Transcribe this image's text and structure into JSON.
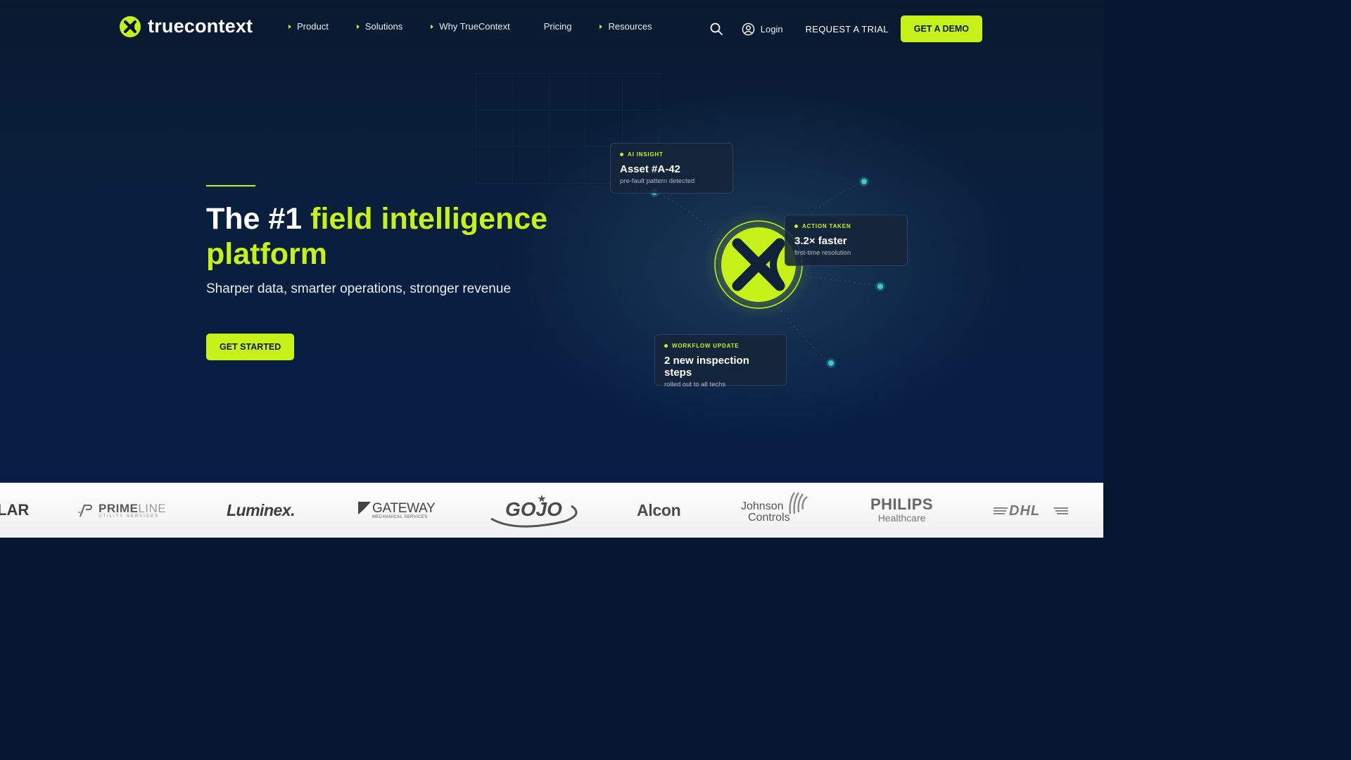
{
  "brand": {
    "name": "truecontext",
    "accent": "#c6f21a"
  },
  "nav": {
    "items": [
      {
        "label": "Product",
        "has_menu": true
      },
      {
        "label": "Solutions",
        "has_menu": true
      },
      {
        "label": "Why TrueContext",
        "has_menu": true
      },
      {
        "label": "Pricing",
        "has_menu": false
      },
      {
        "label": "Resources",
        "has_menu": true
      }
    ],
    "login_label": "Login",
    "trial_label": "REQUEST A TRIAL",
    "demo_label": "GET A DEMO"
  },
  "hero": {
    "title_lead": "The #1 ",
    "title_highlight": "field intelligence platform",
    "subtitle": "Sharper data, smarter operations, stronger revenue",
    "cta_label": "GET STARTED"
  },
  "cards": [
    {
      "tag": "AI INSIGHT",
      "title": "Asset #A-42",
      "desc": "pre-fault pattern detected"
    },
    {
      "tag": "ACTION TAKEN",
      "title": "3.2× faster",
      "desc": "first-time resolution"
    },
    {
      "tag": "WORKFLOW UPDATE",
      "title": "2 new inspection steps",
      "desc": "rolled out to all techs"
    }
  ],
  "customers": {
    "lar": "LAR",
    "primeline_a": "PRIME",
    "primeline_b": "LINE",
    "primeline_sub": "UTILITY SERVICES",
    "luminex": "Luminex.",
    "gateway": "GATEWAY",
    "gateway_sub": "MECHANICAL SERVICES",
    "gojo": "GOJO",
    "alcon": "Alcon",
    "johnson_a": "Johnson",
    "johnson_b": "Controls",
    "philips": "PHILIPS",
    "philips_sub": "Healthcare",
    "dhl": "DHL"
  }
}
